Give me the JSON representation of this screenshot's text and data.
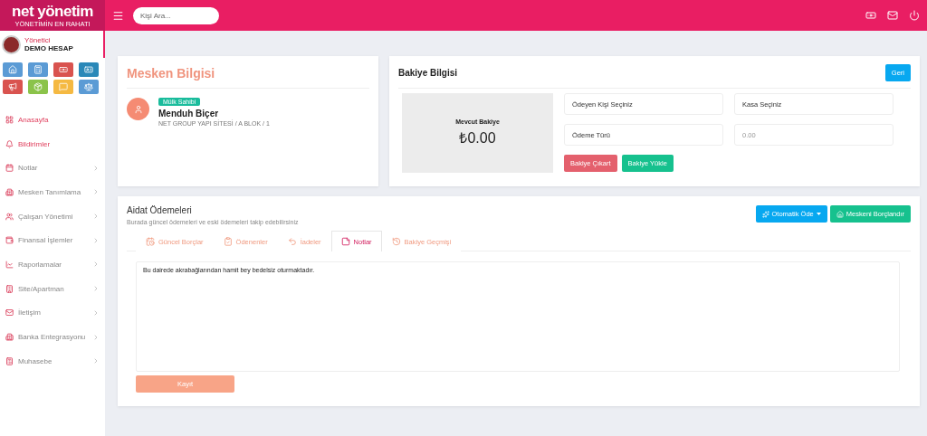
{
  "brand": {
    "name": "net yönetim",
    "tagline": "YÖNETİMİN EN RAHATI"
  },
  "search": {
    "placeholder": "Kişi Ara..."
  },
  "user": {
    "role": "Yönetici",
    "name": "DEMO HESAP"
  },
  "quick_links": [
    {
      "color": "#5b9bd5"
    },
    {
      "color": "#5b9bd5"
    },
    {
      "color": "#d9534f"
    },
    {
      "color": "#2a88b8"
    },
    {
      "color": "#d9534f"
    },
    {
      "color": "#8bc34a"
    },
    {
      "color": "#f5b942"
    },
    {
      "color": "#5b9bd5"
    }
  ],
  "sidebar": {
    "items": [
      {
        "label": "Anasayfa",
        "expandable": false
      },
      {
        "label": "Bildirimler",
        "expandable": false
      },
      {
        "label": "Notlar",
        "expandable": true
      },
      {
        "label": "Mesken Tanımlama",
        "expandable": true
      },
      {
        "label": "Çalışan Yönetimi",
        "expandable": true
      },
      {
        "label": "Finansal İşlemler",
        "expandable": true
      },
      {
        "label": "Raporlamalar",
        "expandable": true
      },
      {
        "label": "Site/Apartman",
        "expandable": true
      },
      {
        "label": "İletişim",
        "expandable": true
      },
      {
        "label": "Banka Entegrasyonu",
        "expandable": true
      },
      {
        "label": "Muhasebe",
        "expandable": true
      }
    ]
  },
  "residence": {
    "title": "Mesken Bilgisi",
    "badge": "Mülk Sahibi",
    "owner": "Menduh Biçer",
    "address": "NET GROUP YAPI SİTESİ / A BLOK / 1"
  },
  "balance": {
    "title": "Bakiye Bilgisi",
    "back_button": "Geri",
    "current_label": "Mevcut Bakiye",
    "current_value": "₺0.00",
    "fields": [
      {
        "placeholder": "Ödeyen Kişi Seçiniz"
      },
      {
        "placeholder": "Kasa Seçiniz"
      },
      {
        "placeholder": "Ödeme Türü"
      },
      {
        "placeholder": "0.00"
      }
    ],
    "buttons": [
      {
        "label": "Bakiye Çıkart",
        "kind": "danger"
      },
      {
        "label": "Bakiye Yükle",
        "kind": "success"
      }
    ]
  },
  "dues": {
    "title": "Aidat Ödemeleri",
    "subtitle": "Burada güncel ödemeleri ve eski ödemeleri takip edebilirsiniz",
    "actions": [
      {
        "label": "Otomatik Öde",
        "kind": "dropdown"
      },
      {
        "label": "Meskeni Borçlandır",
        "kind": "success"
      }
    ],
    "tabs": [
      {
        "label": "Güncel Borçlar",
        "selected": false
      },
      {
        "label": "Ödenenler",
        "selected": false
      },
      {
        "label": "İadeler",
        "selected": false
      },
      {
        "label": "Notlar",
        "selected": true
      },
      {
        "label": "Bakiye Geçmişi",
        "selected": false
      }
    ],
    "note": {
      "value": "Bu dairede akrabağlarından hamit bey bedelsiz oturmaktadır."
    },
    "save_button": "Kayıt"
  }
}
